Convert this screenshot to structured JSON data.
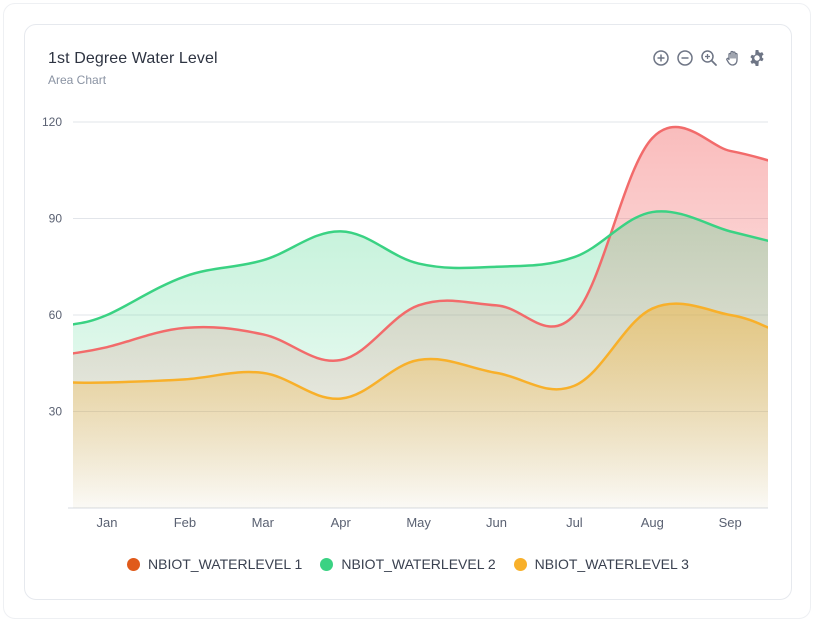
{
  "header": {
    "title": "1st Degree Water Level",
    "subtitle": "Area Chart"
  },
  "toolbar": {
    "icons": [
      "zoom-in-icon",
      "zoom-out-icon",
      "search-zoom-icon",
      "pan-hand-icon",
      "gear-icon"
    ]
  },
  "colors": {
    "series1": "#f26b6b",
    "series1_legend": "#e05a1a",
    "series2": "#3ad283",
    "series3": "#f8b02a",
    "grid": "#e2e5ea",
    "axis_text": "#5a6172"
  },
  "chart_data": {
    "type": "area",
    "categories": [
      "Jan",
      "Feb",
      "Mar",
      "Apr",
      "May",
      "Jun",
      "Jul",
      "Aug",
      "Sep"
    ],
    "ylim": [
      0,
      120
    ],
    "yticks": [
      30,
      60,
      90,
      120
    ],
    "grid": true,
    "legend_position": "bottom",
    "series": [
      {
        "name": "NBIOT_WATERLEVEL 1",
        "values": [
          48,
          50,
          56,
          54,
          46,
          63,
          63,
          60,
          115,
          111,
          108
        ]
      },
      {
        "name": "NBIOT_WATERLEVEL 2",
        "values": [
          57,
          60,
          72,
          77,
          86,
          76,
          75,
          78,
          92,
          86,
          83
        ]
      },
      {
        "name": "NBIOT_WATERLEVEL 3",
        "values": [
          39,
          39,
          40,
          42,
          34,
          46,
          42,
          38,
          62,
          60,
          56
        ]
      }
    ],
    "x_values": [
      -0.45,
      0,
      1,
      2,
      3,
      4,
      5,
      6,
      7,
      8,
      8.5
    ]
  }
}
